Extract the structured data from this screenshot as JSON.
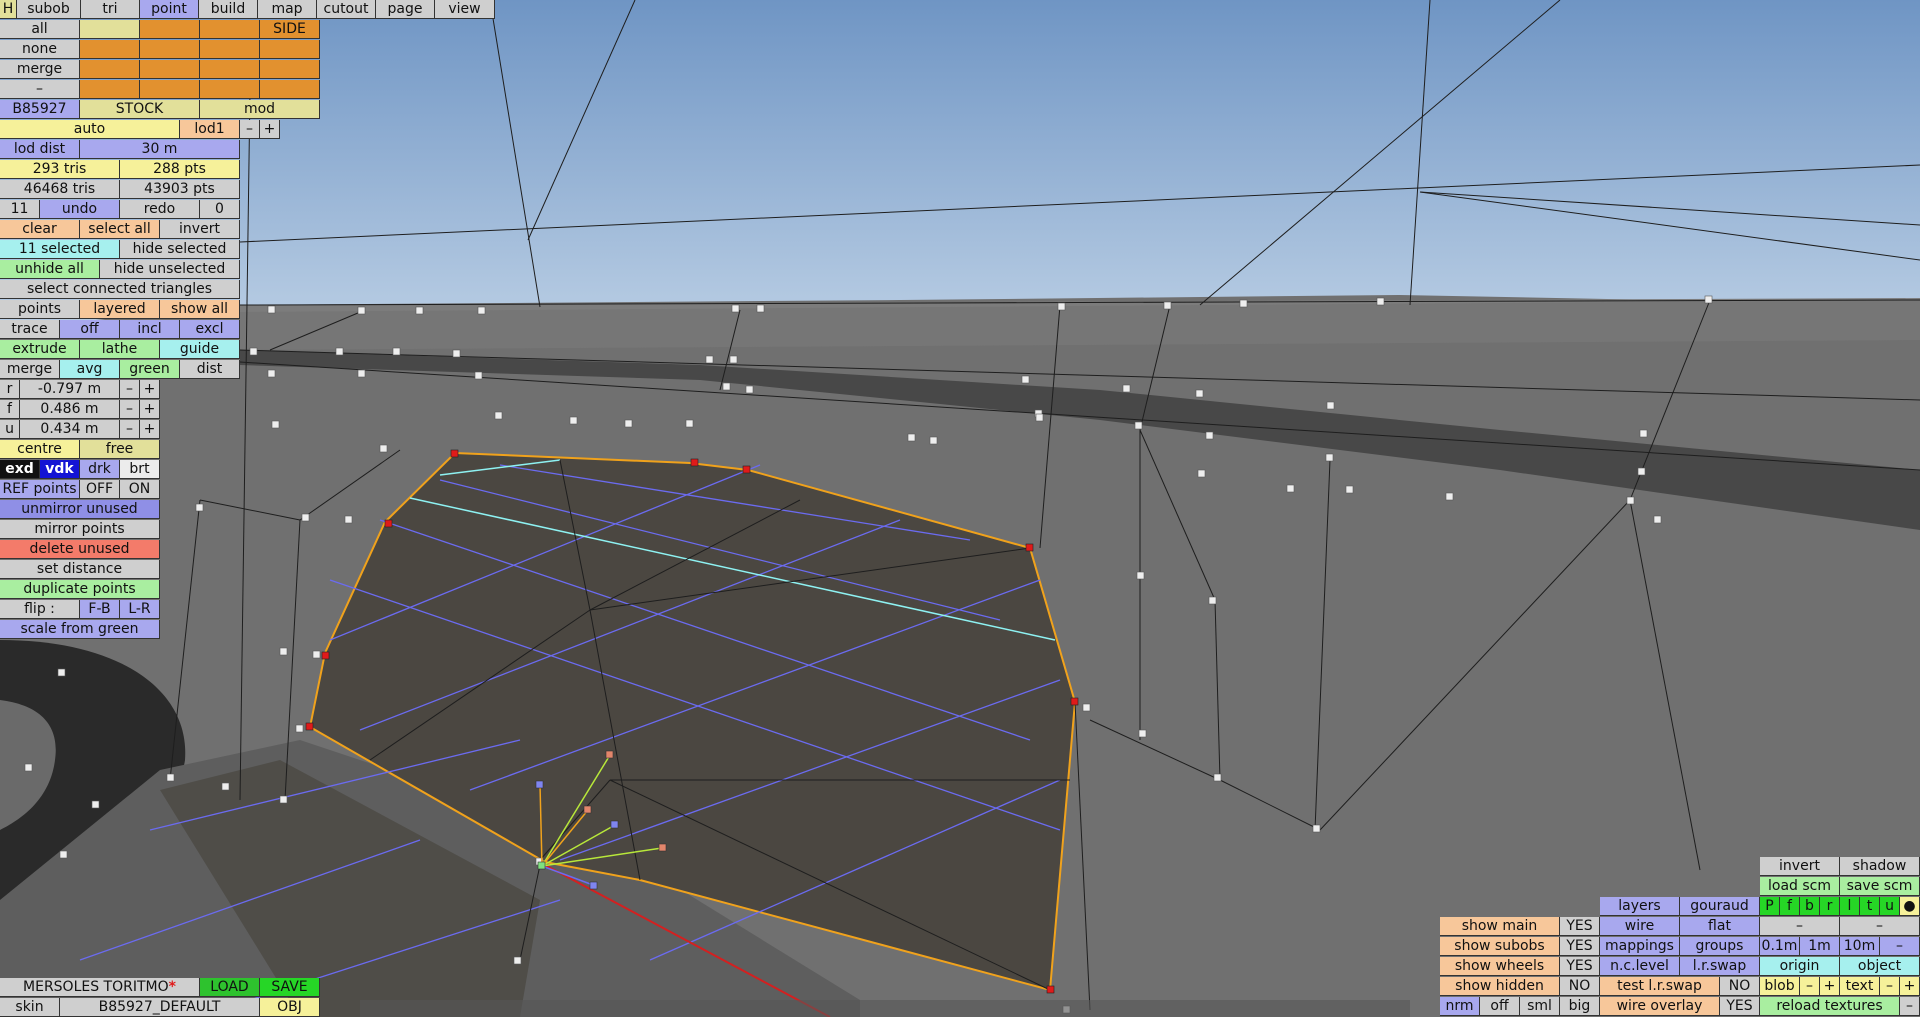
{
  "toolbar": {
    "tabs": [
      "H",
      "subob",
      "tri",
      "point",
      "build",
      "map",
      "cutout",
      "page",
      "view"
    ],
    "rows": [
      "all",
      "none",
      "merge",
      "–"
    ],
    "side": "SIDE"
  },
  "model": {
    "id": "B85927",
    "stock": "STOCK",
    "mod": "mod"
  },
  "lod": {
    "auto": "auto",
    "lod1": "lod1",
    "minus": "–",
    "plus": "+",
    "dist_label": "lod dist",
    "dist_value": "30 m"
  },
  "counts": {
    "tris": "293 tris",
    "pts": "288 pts",
    "total_tris": "46468 tris",
    "total_pts": "43903 pts"
  },
  "history": {
    "undo_count": "11",
    "undo": "undo",
    "redo": "redo",
    "redo_count": "0"
  },
  "selection": {
    "clear": "clear",
    "select_all": "select all",
    "invert": "invert",
    "selected": "11 selected",
    "hide_selected": "hide selected",
    "unhide_all": "unhide all",
    "hide_unselected": "hide unselected",
    "select_connected": "select connected triangles"
  },
  "display": {
    "points": "points",
    "layered": "layered",
    "show_all": "show all"
  },
  "trace": {
    "trace": "trace",
    "off": "off",
    "incl": "incl",
    "excl": "excl"
  },
  "tools": {
    "extrude": "extrude",
    "lathe": "lathe",
    "guide": "guide",
    "merge": "merge",
    "avg": "avg",
    "green": "green",
    "dist": "dist"
  },
  "coords": {
    "r_label": "r",
    "r_value": "-0.797 m",
    "f_label": "f",
    "f_value": "0.486 m",
    "u_label": "u",
    "u_value": "0.434 m",
    "minus": "–",
    "plus": "+"
  },
  "pivot": {
    "centre": "centre",
    "free": "free"
  },
  "shade": {
    "exd": "exd",
    "vdk": "vdk",
    "drk": "drk",
    "brt": "brt"
  },
  "ref": {
    "label": "REF points",
    "off": "OFF",
    "on": "ON"
  },
  "actions": {
    "unmirror": "unmirror unused",
    "mirror": "mirror points",
    "delete": "delete unused",
    "set_distance": "set distance",
    "duplicate": "duplicate points",
    "flip": "flip :",
    "fb": "F-B",
    "lr": "L-R",
    "scale": "scale from green"
  },
  "file": {
    "name": "MERSOLES TORITMO",
    "modified": "*",
    "load": "LOAD",
    "save": "SAVE",
    "skin_label": "skin",
    "skin_value": "B85927_DEFAULT",
    "obj": "OBJ"
  },
  "right_panel": {
    "invert": "invert",
    "shadow": "shadow",
    "load_scm": "load scm",
    "save_scm": "save scm",
    "layers": "layers",
    "gouraud": "gouraud",
    "layer_flags": [
      "P",
      "f",
      "b",
      "r",
      "l",
      "t",
      "u",
      "●"
    ],
    "wire": "wire",
    "flat": "flat",
    "minus": "–",
    "mappings": "mappings",
    "groups": "groups",
    "grid": [
      "0.1m",
      "1m",
      "10m",
      "–"
    ],
    "nc_level": "n.c.level",
    "lr_swap": "l.r.swap",
    "origin": "origin",
    "object": "object",
    "test_lr_swap": "test l.r.swap",
    "no": "NO",
    "blob": "blob",
    "text": "text",
    "plus": "+",
    "wire_overlay": "wire overlay",
    "yes": "YES",
    "reload": "reload textures",
    "show_main": "show main",
    "show_subobs": "show subobs",
    "show_wheels": "show wheels",
    "show_hidden": "show hidden",
    "nrm": "nrm",
    "off": "off",
    "sml": "sml",
    "big": "big"
  },
  "colors": {
    "sky_top": "#6f95c4",
    "sky_bottom": "#b7cce3",
    "surface": "#6f6f6f",
    "panel": "#4b4741",
    "outline": "#f0a21c",
    "guide": "#6b6bf0",
    "cyan": "#8ef2f2",
    "selected_point": "#e01a1a"
  }
}
